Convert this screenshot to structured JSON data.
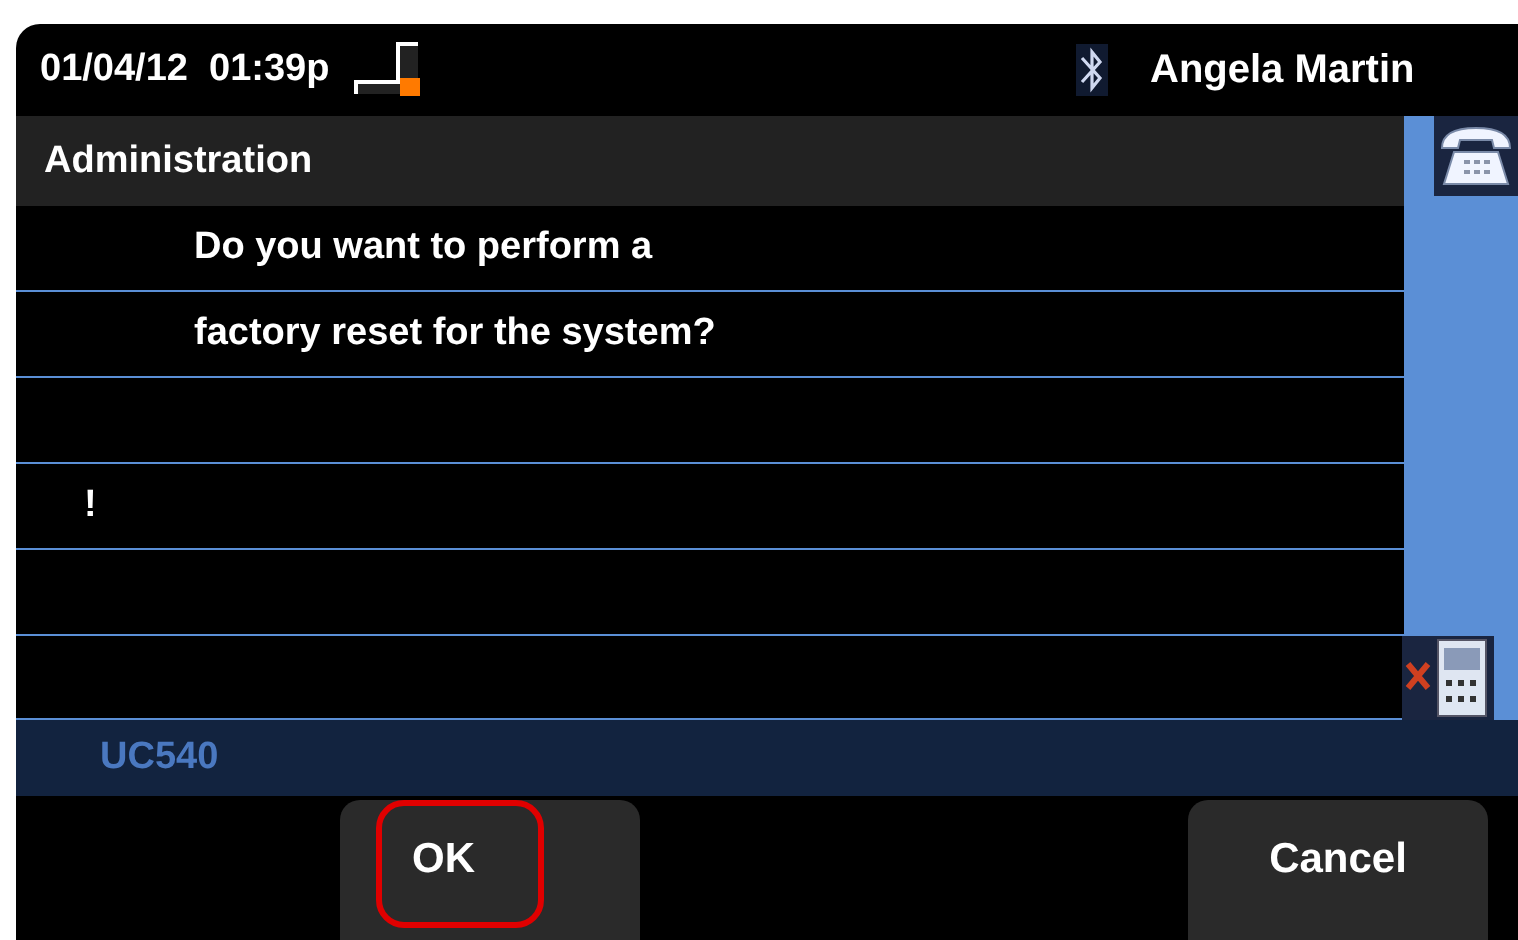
{
  "status_bar": {
    "datetime": "01/04/12  01:39p",
    "user": "Angela Martin"
  },
  "header": {
    "title": "Administration"
  },
  "rows": [
    {
      "kind": "message",
      "text": "Do you want to perform a"
    },
    {
      "kind": "message",
      "text": "factory reset for the system?"
    },
    {
      "kind": "blank"
    },
    {
      "kind": "alert",
      "text": "!"
    },
    {
      "kind": "blank"
    },
    {
      "kind": "blank"
    }
  ],
  "footer": {
    "label": "UC540"
  },
  "softkeys": [
    {
      "label": "OK",
      "highlighted": true
    },
    {
      "label": "Cancel",
      "highlighted": false
    }
  ]
}
